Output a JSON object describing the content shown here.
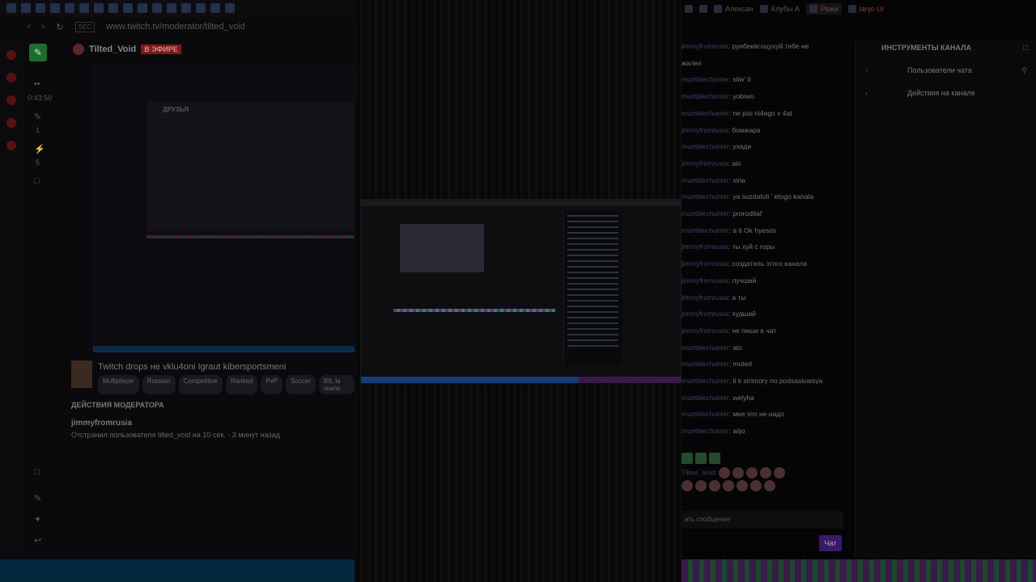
{
  "left": {
    "url": "www.twitch.tv/moderator/tilted_void",
    "channel": "Tilted_Void",
    "live_badge": "В ЭФИРЕ",
    "uptime": "0:43:50",
    "count1": "1",
    "count2": "5",
    "friends_label": "ДРУЗЬЯ",
    "stream_title": "Twitch drops не vklu4oni  Igraut kibersportsmeni",
    "tags": [
      "Multiplayer",
      "Russian",
      "Competitive",
      "Ranked",
      "PvP",
      "Soccer",
      "BIt, la reano"
    ],
    "mod_actions_header": "ДЕЙСТВИЯ МОДЕРАТОРА",
    "mod_user": "jimmyfromrusia",
    "mod_action": "Отстранил пользователя tilted_void на 10 сек.",
    "mod_time": "- 3 минут назад"
  },
  "right": {
    "tabs": [
      "Алексан",
      "Клубы А",
      "Режи",
      "lanjo Ur"
    ],
    "chat": [
      {
        "user": "jimmyfromrusia",
        "msg": ": pyибекясоцухуй тебе не"
      },
      {
        "user": "",
        "msg": "жалел"
      },
      {
        "user": "mumblechunter",
        "msg": ": siiw' ti"
      },
      {
        "user": "mumblechunter",
        "msg": ": yobiwo"
      },
      {
        "user": "mumblechunter",
        "msg": ": ne pisi ni4ego v 4at"
      },
      {
        "user": "jimmyfromrusia",
        "msg": ": бомжара"
      },
      {
        "user": "mumblechunter",
        "msg": ": ухади"
      },
      {
        "user": "jimmyfromrusia",
        "msg": ": alo"
      },
      {
        "user": "mumblechunter",
        "msg": ": sina"
      },
      {
        "user": "mumblechunter",
        "msg": ": ya sozdatoli ' etogo kanala"
      },
      {
        "user": "mumblechunter",
        "msg": ": prorodital'"
      },
      {
        "user": "mumblechunter",
        "msg": ": a ti Ok hyesos"
      },
      {
        "user": "jimmyfromrusia",
        "msg": ": ты хуй с горы"
      },
      {
        "user": "jimmyfromrusia",
        "msg": ": создатель этого канала"
      },
      {
        "user": "jimmyfromrusia",
        "msg": ": лучший"
      },
      {
        "user": "jimmyfromrusia",
        "msg": ": а ты"
      },
      {
        "user": "jimmyfromrusia",
        "msg": ": худший"
      },
      {
        "user": "jimmyfromrusia",
        "msg": ": не пиши в чат"
      },
      {
        "user": "mumblechunter",
        "msg": ": alo"
      },
      {
        "user": "mumblechunter",
        "msg": ": muted"
      },
      {
        "user": "mumblechunter",
        "msg": ": ti k strimory no podsasivaisya"
      },
      {
        "user": "mumblechunter",
        "msg": ": welyha"
      },
      {
        "user": "mumblechunter",
        "msg": ": мне это не надо"
      },
      {
        "user": "mumblechunter",
        "msg": ": aiijo"
      }
    ],
    "emote_user": "Tilted_Void:",
    "chat_placeholder": "ать сообщение",
    "chat_button": "Чат",
    "tools_header": "ИНСТРУМЕНТЫ КАНАЛА",
    "tools_rows": [
      "Пользователи чата",
      "Действия на канале"
    ]
  }
}
